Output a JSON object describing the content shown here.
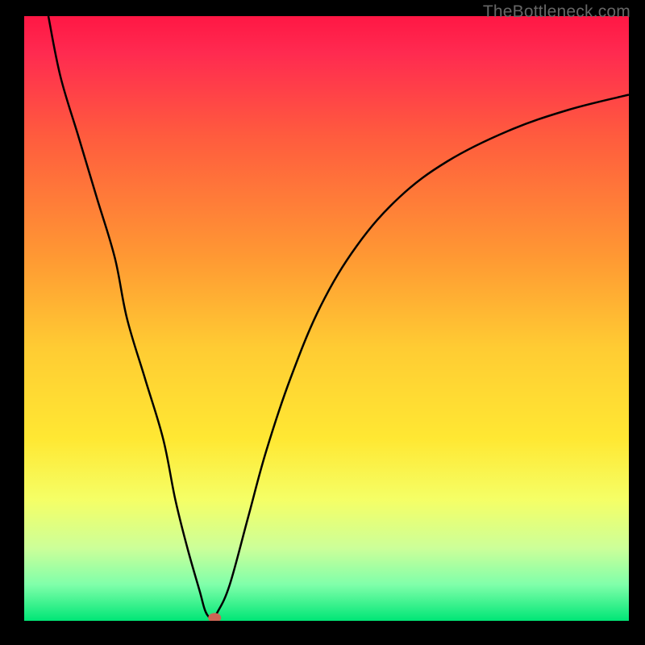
{
  "watermark": "TheBottleneck.com",
  "chart_data": {
    "type": "line",
    "title": "",
    "xlabel": "",
    "ylabel": "",
    "xlim": [
      0,
      100
    ],
    "ylim": [
      0,
      100
    ],
    "gradient_stops": [
      {
        "offset": 0,
        "color": "#ff1744"
      },
      {
        "offset": 0.06,
        "color": "#ff2a50"
      },
      {
        "offset": 0.2,
        "color": "#ff5c3e"
      },
      {
        "offset": 0.4,
        "color": "#ff9933"
      },
      {
        "offset": 0.55,
        "color": "#ffcc33"
      },
      {
        "offset": 0.7,
        "color": "#ffe833"
      },
      {
        "offset": 0.8,
        "color": "#f5ff66"
      },
      {
        "offset": 0.88,
        "color": "#ccff99"
      },
      {
        "offset": 0.94,
        "color": "#80ffaa"
      },
      {
        "offset": 1.0,
        "color": "#00e676"
      }
    ],
    "series": [
      {
        "name": "bottleneck-curve",
        "color": "#000000",
        "points": [
          {
            "x": 4,
            "y": 100
          },
          {
            "x": 6,
            "y": 90
          },
          {
            "x": 9,
            "y": 80
          },
          {
            "x": 12,
            "y": 70
          },
          {
            "x": 15,
            "y": 60
          },
          {
            "x": 17,
            "y": 50
          },
          {
            "x": 20,
            "y": 40
          },
          {
            "x": 23,
            "y": 30
          },
          {
            "x": 25,
            "y": 20
          },
          {
            "x": 27,
            "y": 12
          },
          {
            "x": 29,
            "y": 5
          },
          {
            "x": 30,
            "y": 1.5
          },
          {
            "x": 31,
            "y": 0.5
          },
          {
            "x": 32,
            "y": 1.5
          },
          {
            "x": 34,
            "y": 6
          },
          {
            "x": 37,
            "y": 17
          },
          {
            "x": 40,
            "y": 28
          },
          {
            "x": 44,
            "y": 40
          },
          {
            "x": 49,
            "y": 52
          },
          {
            "x": 55,
            "y": 62
          },
          {
            "x": 62,
            "y": 70
          },
          {
            "x": 70,
            "y": 76
          },
          {
            "x": 80,
            "y": 81
          },
          {
            "x": 90,
            "y": 84.5
          },
          {
            "x": 100,
            "y": 87
          }
        ]
      }
    ],
    "marker": {
      "x": 31.5,
      "y": 0.5,
      "color": "#cc6655",
      "radius": 7
    }
  }
}
